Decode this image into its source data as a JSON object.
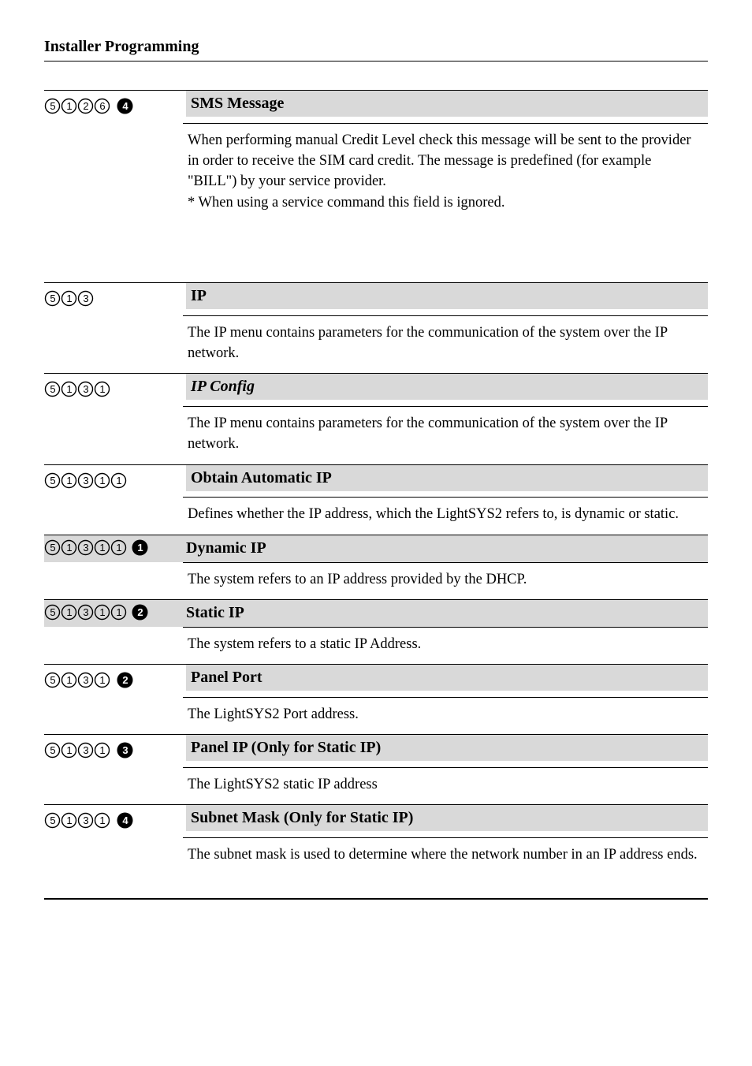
{
  "page_header": "Installer Programming",
  "first_section": {
    "code_glyphs": [
      "c5",
      "c1",
      "c2",
      "c6",
      "b4"
    ],
    "heading": "SMS Message",
    "body": "When performing manual Credit Level check this message will be sent to the provider in order to receive the SIM card credit. The message is predefined (for example \"BILL\") by your service provider.\n* When using a service command this field is ignored."
  },
  "rows": [
    {
      "code_glyphs": [
        "c5",
        "c1",
        "c3"
      ],
      "heading": "IP",
      "heading_italic": false,
      "desc": "The IP menu contains parameters for the communication of the system over the IP network.",
      "full_width_heading": false
    },
    {
      "code_glyphs": [
        "c5",
        "c1",
        "c3",
        "c1"
      ],
      "heading": "IP Config",
      "heading_italic": true,
      "desc": " The IP menu contains parameters for the communication of the system over the IP network.",
      "full_width_heading": false
    },
    {
      "code_glyphs": [
        "c5",
        "c1",
        "c3",
        "c1",
        "c1"
      ],
      "heading": "Obtain Automatic IP",
      "heading_italic": false,
      "desc": "Defines whether the IP address, which the LightSYS2 refers to, is dynamic or static.",
      "full_width_heading": false
    },
    {
      "code_glyphs": [
        "c5",
        "c1",
        "c3",
        "c1",
        "c1",
        "b1"
      ],
      "heading": "Dynamic IP",
      "heading_italic": false,
      "desc": "The system refers to an IP address provided by the DHCP.",
      "full_width_heading": true
    },
    {
      "code_glyphs": [
        "c5",
        "c1",
        "c3",
        "c1",
        "c1",
        "b2"
      ],
      "heading": "Static IP",
      "heading_italic": false,
      "desc": "The system refers to a static IP Address.",
      "full_width_heading": true
    },
    {
      "code_glyphs": [
        "c5",
        "c1",
        "c3",
        "c1",
        "b2"
      ],
      "heading": "Panel Port",
      "heading_italic": false,
      "desc": "The LightSYS2 Port address.",
      "full_width_heading": false
    },
    {
      "code_glyphs": [
        "c5",
        "c1",
        "c3",
        "c1",
        "b3"
      ],
      "heading": "Panel IP (Only for Static IP)",
      "heading_italic": false,
      "desc": "The LightSYS2 static IP address",
      "full_width_heading": false
    },
    {
      "code_glyphs": [
        "c5",
        "c1",
        "c3",
        "c1",
        "b4"
      ],
      "heading": "Subnet Mask (Only for Static IP)",
      "heading_italic": false,
      "desc": "The subnet mask is used to determine where the network number in an IP address ends.",
      "full_width_heading": false
    }
  ]
}
